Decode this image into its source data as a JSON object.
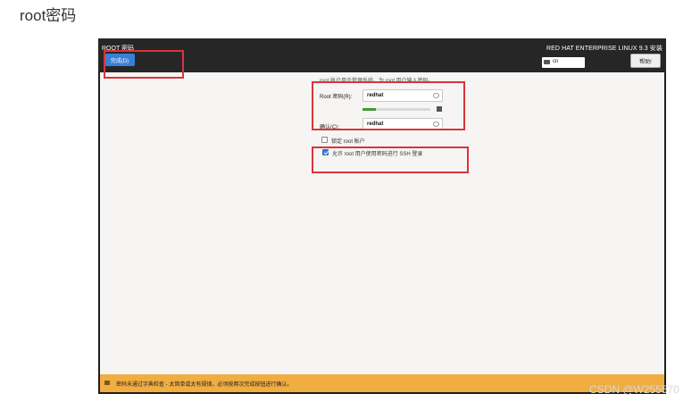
{
  "page_heading": "root密码",
  "installer": {
    "screen_title": "ROOT 密码",
    "done_label": "完成(D)",
    "product_title": "RED HAT ENTERPRISE LINUX 9.3 安装",
    "keyboard_layout": "cn",
    "help_label": "帮助!"
  },
  "form": {
    "hint": "root 帐户用于管理系统。为 root 用户输入密码。",
    "password_label": "Root 密码(R):",
    "password_value": "redhat",
    "strength_fraction": 0.2,
    "confirm_label": "确认(C):",
    "confirm_value": "redhat",
    "lock_root_label": "锁定 root 帐户",
    "lock_root_checked": false,
    "allow_ssh_label": "允许 root 用户使用密码进行 SSH 登录",
    "allow_ssh_checked": true
  },
  "warning": {
    "text": "密码未通过字典检查 - 太简单或太有规律。必须按两次完成按钮进行确认。"
  },
  "watermark": "CSDN @W255570",
  "colors": {
    "accent": "#3a7fd6",
    "warning": "#f0ad42",
    "annotation": "#d9343a",
    "strength": "#3f9c35"
  }
}
